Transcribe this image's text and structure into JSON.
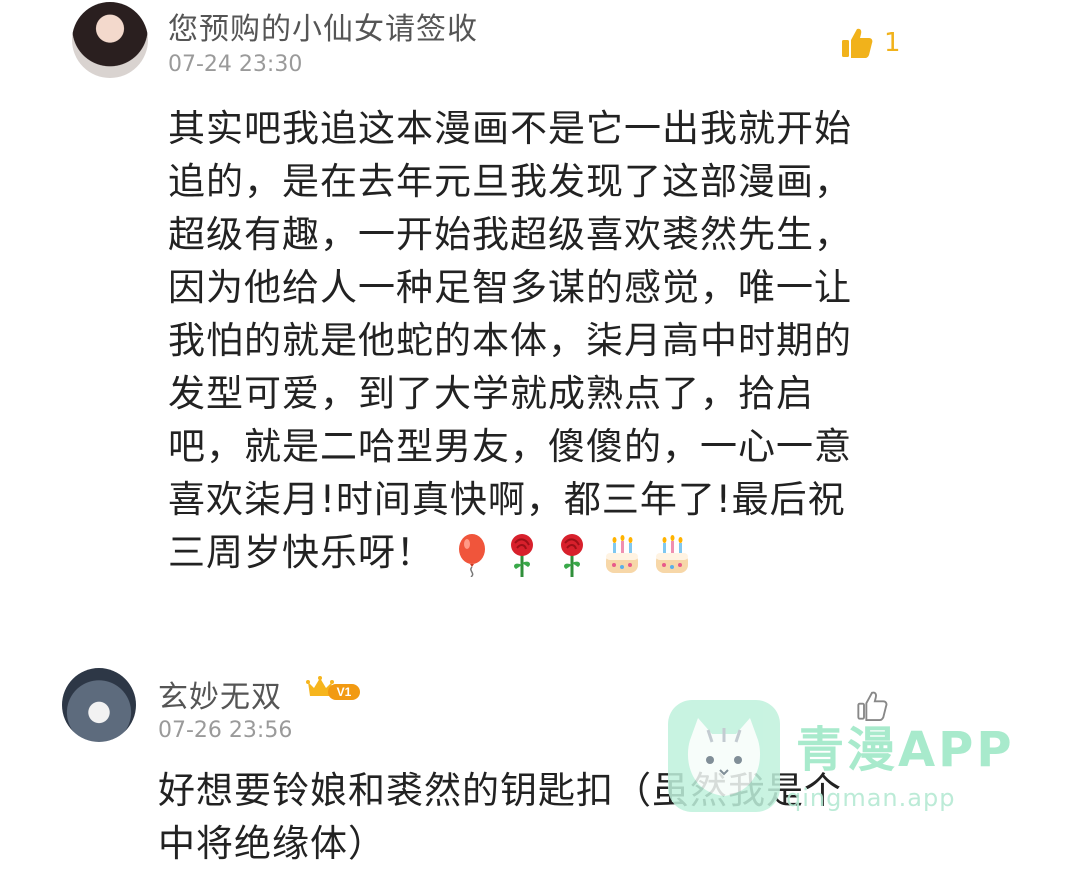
{
  "comments": [
    {
      "username": "您预购的小仙女请签收",
      "time": "07-24 23:30",
      "like_count": "1",
      "lines": [
        "其实吧我追这本漫画不是它一出我就开始",
        "追的，是在去年元旦我发现了这部漫画，",
        "超级有趣，一开始我超级喜欢裘然先生，",
        "因为他给人一种足智多谋的感觉，唯一让",
        "我怕的就是他蛇的本体，柒月高中时期的",
        "发型可爱，到了大学就成熟点了，拾启",
        "吧，就是二哈型男友，傻傻的，一心一意",
        "喜欢柒月!时间真快啊，都三年了!最后祝",
        "三周岁快乐呀！"
      ],
      "emojis": [
        "balloon-emoji",
        "rose-emoji",
        "rose-emoji",
        "cake-emoji",
        "cake-emoji"
      ]
    },
    {
      "username": "玄妙无双",
      "badge": "V1",
      "time": "07-26 23:56",
      "lines": [
        "好想要铃娘和裘然的钥匙扣（虽然我是个",
        "中将绝缘体）"
      ]
    }
  ],
  "watermark": {
    "title": "青漫APP",
    "url": "qingman.app"
  },
  "colors": {
    "like_active": "#f1b21b",
    "meta_gray": "#9a9a9a",
    "watermark_green": "#9fe8c7"
  }
}
